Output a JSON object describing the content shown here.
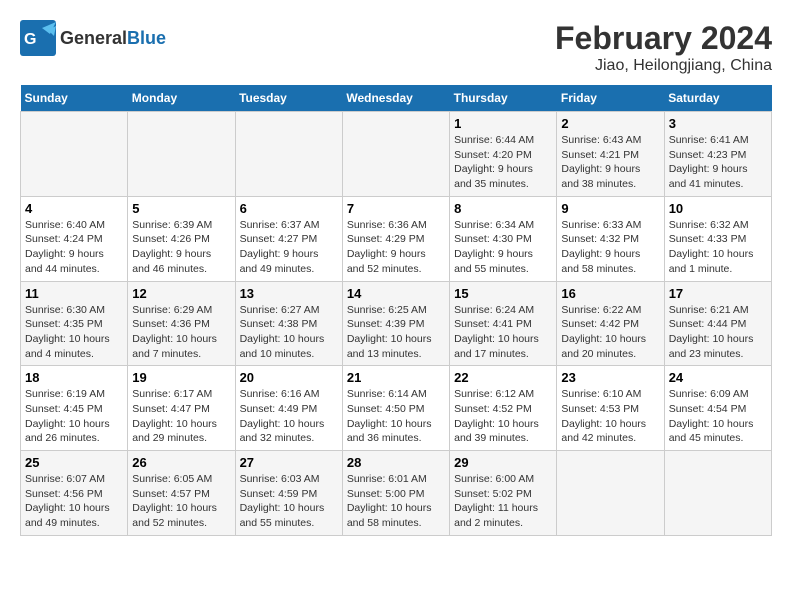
{
  "header": {
    "logo_general": "General",
    "logo_blue": "Blue",
    "title": "February 2024",
    "subtitle": "Jiao, Heilongjiang, China"
  },
  "days_of_week": [
    "Sunday",
    "Monday",
    "Tuesday",
    "Wednesday",
    "Thursday",
    "Friday",
    "Saturday"
  ],
  "weeks": [
    [
      {
        "day": "",
        "info": ""
      },
      {
        "day": "",
        "info": ""
      },
      {
        "day": "",
        "info": ""
      },
      {
        "day": "",
        "info": ""
      },
      {
        "day": "1",
        "info": "Sunrise: 6:44 AM\nSunset: 4:20 PM\nDaylight: 9 hours\nand 35 minutes."
      },
      {
        "day": "2",
        "info": "Sunrise: 6:43 AM\nSunset: 4:21 PM\nDaylight: 9 hours\nand 38 minutes."
      },
      {
        "day": "3",
        "info": "Sunrise: 6:41 AM\nSunset: 4:23 PM\nDaylight: 9 hours\nand 41 minutes."
      }
    ],
    [
      {
        "day": "4",
        "info": "Sunrise: 6:40 AM\nSunset: 4:24 PM\nDaylight: 9 hours\nand 44 minutes."
      },
      {
        "day": "5",
        "info": "Sunrise: 6:39 AM\nSunset: 4:26 PM\nDaylight: 9 hours\nand 46 minutes."
      },
      {
        "day": "6",
        "info": "Sunrise: 6:37 AM\nSunset: 4:27 PM\nDaylight: 9 hours\nand 49 minutes."
      },
      {
        "day": "7",
        "info": "Sunrise: 6:36 AM\nSunset: 4:29 PM\nDaylight: 9 hours\nand 52 minutes."
      },
      {
        "day": "8",
        "info": "Sunrise: 6:34 AM\nSunset: 4:30 PM\nDaylight: 9 hours\nand 55 minutes."
      },
      {
        "day": "9",
        "info": "Sunrise: 6:33 AM\nSunset: 4:32 PM\nDaylight: 9 hours\nand 58 minutes."
      },
      {
        "day": "10",
        "info": "Sunrise: 6:32 AM\nSunset: 4:33 PM\nDaylight: 10 hours\nand 1 minute."
      }
    ],
    [
      {
        "day": "11",
        "info": "Sunrise: 6:30 AM\nSunset: 4:35 PM\nDaylight: 10 hours\nand 4 minutes."
      },
      {
        "day": "12",
        "info": "Sunrise: 6:29 AM\nSunset: 4:36 PM\nDaylight: 10 hours\nand 7 minutes."
      },
      {
        "day": "13",
        "info": "Sunrise: 6:27 AM\nSunset: 4:38 PM\nDaylight: 10 hours\nand 10 minutes."
      },
      {
        "day": "14",
        "info": "Sunrise: 6:25 AM\nSunset: 4:39 PM\nDaylight: 10 hours\nand 13 minutes."
      },
      {
        "day": "15",
        "info": "Sunrise: 6:24 AM\nSunset: 4:41 PM\nDaylight: 10 hours\nand 17 minutes."
      },
      {
        "day": "16",
        "info": "Sunrise: 6:22 AM\nSunset: 4:42 PM\nDaylight: 10 hours\nand 20 minutes."
      },
      {
        "day": "17",
        "info": "Sunrise: 6:21 AM\nSunset: 4:44 PM\nDaylight: 10 hours\nand 23 minutes."
      }
    ],
    [
      {
        "day": "18",
        "info": "Sunrise: 6:19 AM\nSunset: 4:45 PM\nDaylight: 10 hours\nand 26 minutes."
      },
      {
        "day": "19",
        "info": "Sunrise: 6:17 AM\nSunset: 4:47 PM\nDaylight: 10 hours\nand 29 minutes."
      },
      {
        "day": "20",
        "info": "Sunrise: 6:16 AM\nSunset: 4:49 PM\nDaylight: 10 hours\nand 32 minutes."
      },
      {
        "day": "21",
        "info": "Sunrise: 6:14 AM\nSunset: 4:50 PM\nDaylight: 10 hours\nand 36 minutes."
      },
      {
        "day": "22",
        "info": "Sunrise: 6:12 AM\nSunset: 4:52 PM\nDaylight: 10 hours\nand 39 minutes."
      },
      {
        "day": "23",
        "info": "Sunrise: 6:10 AM\nSunset: 4:53 PM\nDaylight: 10 hours\nand 42 minutes."
      },
      {
        "day": "24",
        "info": "Sunrise: 6:09 AM\nSunset: 4:54 PM\nDaylight: 10 hours\nand 45 minutes."
      }
    ],
    [
      {
        "day": "25",
        "info": "Sunrise: 6:07 AM\nSunset: 4:56 PM\nDaylight: 10 hours\nand 49 minutes."
      },
      {
        "day": "26",
        "info": "Sunrise: 6:05 AM\nSunset: 4:57 PM\nDaylight: 10 hours\nand 52 minutes."
      },
      {
        "day": "27",
        "info": "Sunrise: 6:03 AM\nSunset: 4:59 PM\nDaylight: 10 hours\nand 55 minutes."
      },
      {
        "day": "28",
        "info": "Sunrise: 6:01 AM\nSunset: 5:00 PM\nDaylight: 10 hours\nand 58 minutes."
      },
      {
        "day": "29",
        "info": "Sunrise: 6:00 AM\nSunset: 5:02 PM\nDaylight: 11 hours\nand 2 minutes."
      },
      {
        "day": "",
        "info": ""
      },
      {
        "day": "",
        "info": ""
      }
    ]
  ]
}
